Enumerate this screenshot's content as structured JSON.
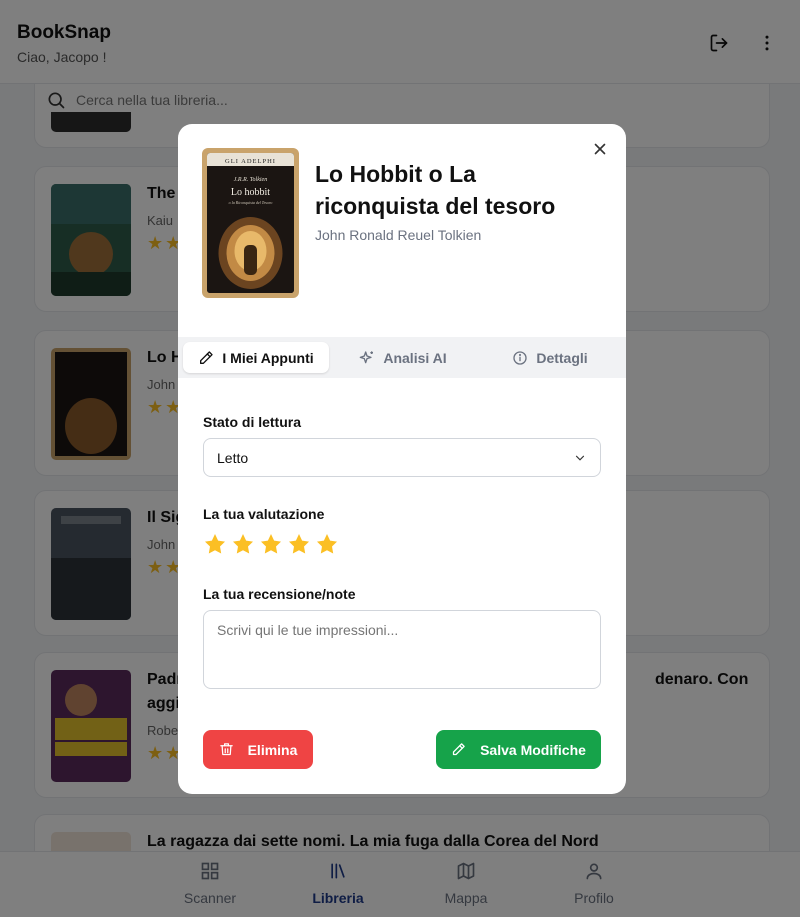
{
  "app": {
    "brand": "BookSnap",
    "greeting": "Ciao, Jacopo !",
    "search_placeholder": "Cerca nella tua libreria..."
  },
  "library": [
    {
      "title": "The Promised Neverland",
      "title_visible": "The ",
      "author": "Kaiu Shirai",
      "author_visible": "Kaiu",
      "stars": "★★"
    },
    {
      "title": "Lo Hobbit o La riconquista del tesoro",
      "title_visible": "Lo H",
      "author_visible": "John",
      "stars": "★★"
    },
    {
      "title": "Il Signore degli Anelli",
      "title_visible": "Il Sig",
      "author_visible": "John",
      "stars": "★★"
    },
    {
      "title_visible": "Padre ricco padre povero. Quello che i ricchi insegnano ai figli sul denaro. Con",
      "title_line1": "Padr",
      "title_line1_right": "denaro. Con",
      "title_line2": "aggi",
      "author_visible": "Robe",
      "stars": "★★"
    },
    {
      "title": "La ragazza dai sette nomi. La mia fuga dalla Corea del Nord"
    }
  ],
  "bottom_nav": [
    {
      "label": "Scanner",
      "icon": "grid-icon",
      "active": false
    },
    {
      "label": "Libreria",
      "icon": "library-icon",
      "active": true
    },
    {
      "label": "Mappa",
      "icon": "map-icon",
      "active": false
    },
    {
      "label": "Profilo",
      "icon": "user-icon",
      "active": false
    }
  ],
  "modal": {
    "cover_publisher": "GLI ADELPHI",
    "cover_author": "J.R.R. Tolkien",
    "cover_title": "Lo hobbit",
    "cover_subtitle": "o la Riconquista del Tesoro",
    "title": "Lo Hobbit o La riconquista del tesoro",
    "author": "John Ronald Reuel Tolkien",
    "tabs": [
      {
        "label": "I Miei Appunti",
        "icon": "pencil-icon",
        "active": true
      },
      {
        "label": "Analisi AI",
        "icon": "sparkles-icon",
        "active": false
      },
      {
        "label": "Dettagli",
        "icon": "info-icon",
        "active": false
      }
    ],
    "reading_status_label": "Stato di lettura",
    "reading_status_value": "Letto",
    "rating_label": "La tua valutazione",
    "rating": 5,
    "rating_max": 5,
    "review_label": "La tua recensione/note",
    "review_placeholder": "Scrivi qui le tue impressioni...",
    "delete_label": "Elimina",
    "save_label": "Salva Modifiche"
  },
  "colors": {
    "star": "#fbbf24",
    "delete": "#ef4444",
    "save": "#16a34a",
    "active_nav": "#1e3a8a"
  }
}
